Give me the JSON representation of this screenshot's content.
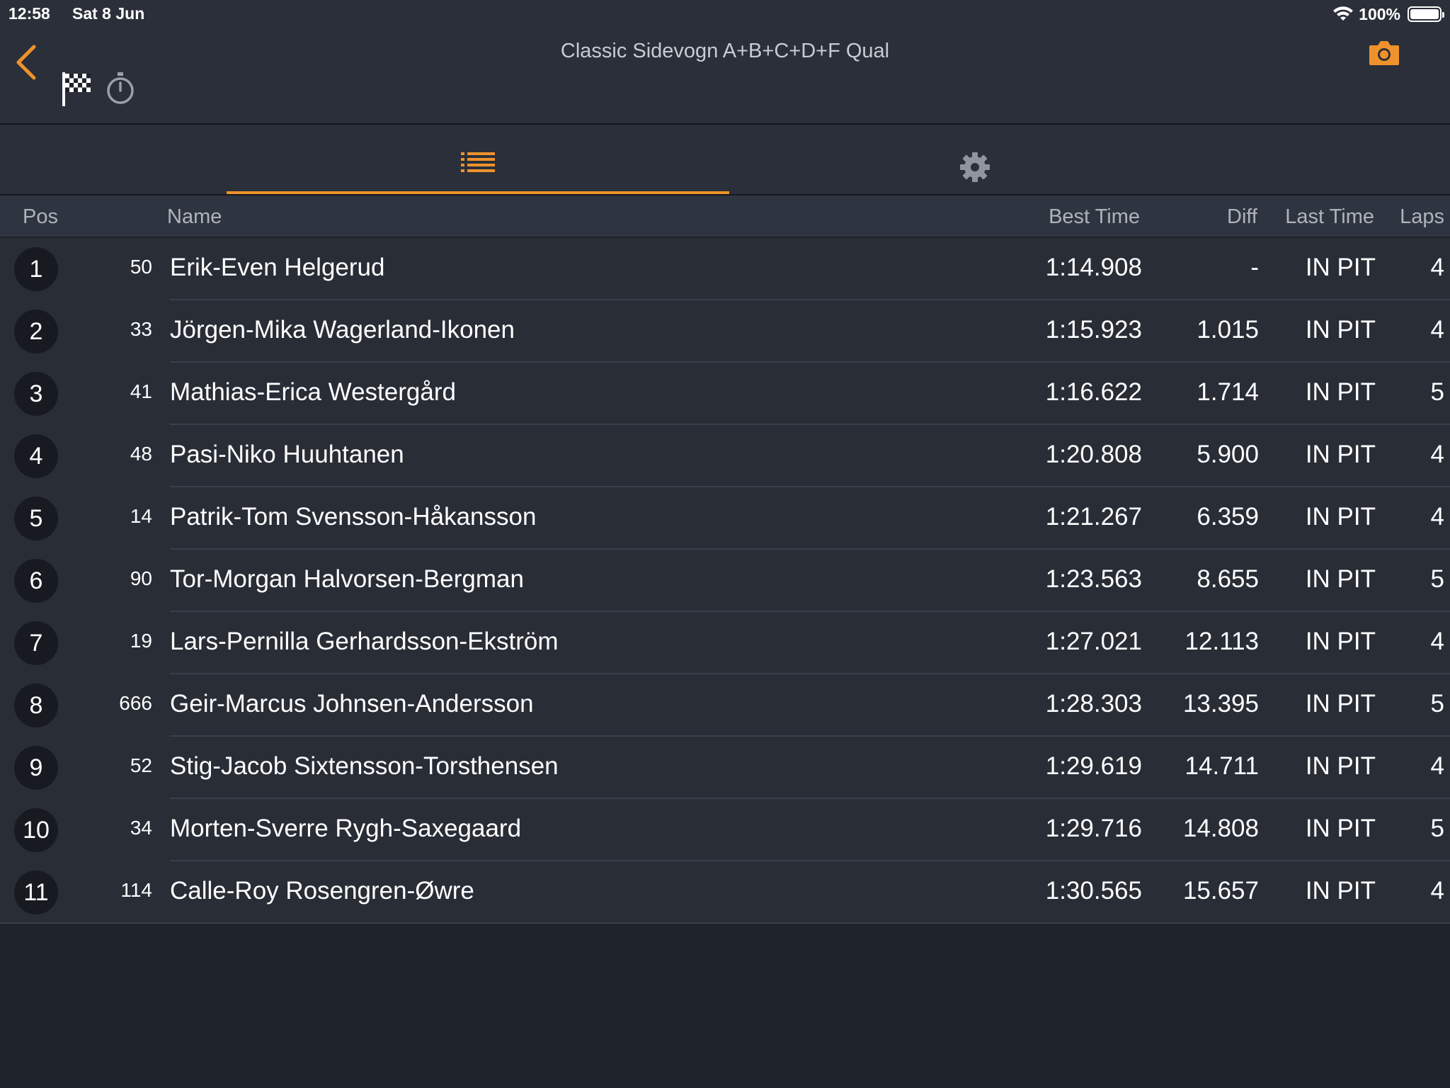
{
  "status": {
    "time": "12:58",
    "date": "Sat 8 Jun",
    "battery": "100%"
  },
  "nav": {
    "title": "Classic Sidevogn A+B+C+D+F Qual",
    "back_icon": "chevron-left-icon",
    "camera_icon": "camera-icon",
    "accent_color": "#f0922b"
  },
  "tabs": [
    {
      "name": "list-icon",
      "active": true
    },
    {
      "name": "gear-icon",
      "active": false
    }
  ],
  "table": {
    "headers": {
      "pos": "Pos",
      "name": "Name",
      "best": "Best Time",
      "diff": "Diff",
      "last": "Last Time",
      "laps": "Laps"
    },
    "rows": [
      {
        "pos": "1",
        "num": "50",
        "name": "Erik-Even Helgerud",
        "best": "1:14.908",
        "diff": "-",
        "last": "IN PIT",
        "laps": "4"
      },
      {
        "pos": "2",
        "num": "33",
        "name": "Jörgen-Mika Wagerland-Ikonen",
        "best": "1:15.923",
        "diff": "1.015",
        "last": "IN PIT",
        "laps": "4"
      },
      {
        "pos": "3",
        "num": "41",
        "name": "Mathias-Erica Westergård",
        "best": "1:16.622",
        "diff": "1.714",
        "last": "IN PIT",
        "laps": "5"
      },
      {
        "pos": "4",
        "num": "48",
        "name": "Pasi-Niko Huuhtanen",
        "best": "1:20.808",
        "diff": "5.900",
        "last": "IN PIT",
        "laps": "4"
      },
      {
        "pos": "5",
        "num": "14",
        "name": "Patrik-Tom Svensson-Håkansson",
        "best": "1:21.267",
        "diff": "6.359",
        "last": "IN PIT",
        "laps": "4"
      },
      {
        "pos": "6",
        "num": "90",
        "name": "Tor-Morgan Halvorsen-Bergman",
        "best": "1:23.563",
        "diff": "8.655",
        "last": "IN PIT",
        "laps": "5"
      },
      {
        "pos": "7",
        "num": "19",
        "name": "Lars-Pernilla Gerhardsson-Ekström",
        "best": "1:27.021",
        "diff": "12.113",
        "last": "IN PIT",
        "laps": "4"
      },
      {
        "pos": "8",
        "num": "666",
        "name": "Geir-Marcus Johnsen-Andersson",
        "best": "1:28.303",
        "diff": "13.395",
        "last": "IN PIT",
        "laps": "5"
      },
      {
        "pos": "9",
        "num": "52",
        "name": "Stig-Jacob Sixtensson-Torsthensen",
        "best": "1:29.619",
        "diff": "14.711",
        "last": "IN PIT",
        "laps": "4"
      },
      {
        "pos": "10",
        "num": "34",
        "name": "Morten-Sverre Rygh-Saxegaard",
        "best": "1:29.716",
        "diff": "14.808",
        "last": "IN PIT",
        "laps": "5"
      },
      {
        "pos": "11",
        "num": "114",
        "name": "Calle-Roy Rosengren-Øwre",
        "best": "1:30.565",
        "diff": "15.657",
        "last": "IN PIT",
        "laps": "4"
      }
    ]
  }
}
